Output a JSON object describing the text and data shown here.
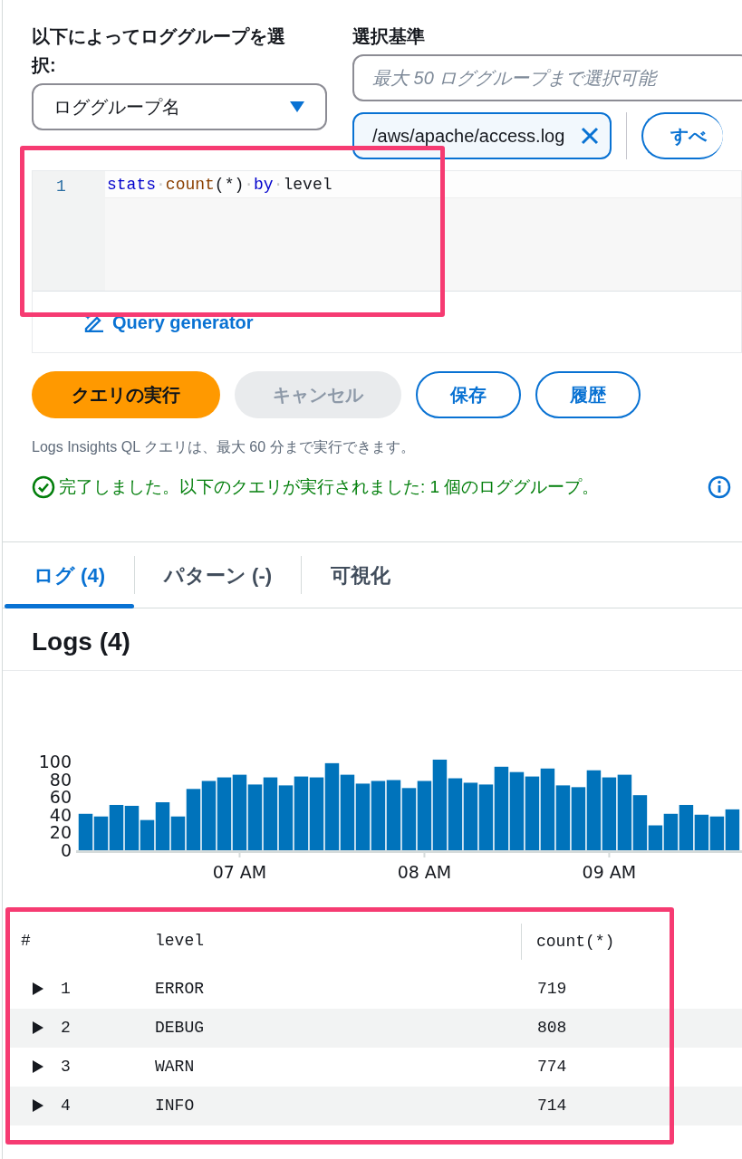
{
  "log_group_selector": {
    "label": "以下によってロググループを選択:",
    "value": "ロググループ名"
  },
  "criteria": {
    "label": "選択基準",
    "placeholder": "最大 50 ロググループまで選択可能",
    "tokens": [
      {
        "label": "/aws/apache/access.log"
      }
    ],
    "button": "すべ"
  },
  "editor": {
    "highlighted": true,
    "lines": [
      {
        "number": "1",
        "tokens": [
          {
            "text": "stats",
            "kind": "keyword"
          },
          {
            "text": "·",
            "kind": "space"
          },
          {
            "text": "count",
            "kind": "function"
          },
          {
            "text": "(*)",
            "kind": "plain"
          },
          {
            "text": "·",
            "kind": "space"
          },
          {
            "text": "by",
            "kind": "keyword"
          },
          {
            "text": "·",
            "kind": "space"
          },
          {
            "text": "level",
            "kind": "plain"
          }
        ]
      }
    ],
    "query_generator": "Query generator"
  },
  "buttons": [
    {
      "label": "クエリの実行",
      "kind": "primary"
    },
    {
      "label": "キャンセル",
      "kind": "disabled"
    },
    {
      "label": "保存",
      "kind": "outline"
    },
    {
      "label": "履歴",
      "kind": "outline"
    }
  ],
  "hint": "Logs Insights QL クエリは、最大 60 分まで実行できます。",
  "status": {
    "kind": "success",
    "text": "完了しました。以下のクエリが実行されました: 1 個のロググループ。"
  },
  "tabs": [
    {
      "label": "ログ (4)",
      "selected": true
    },
    {
      "label": "パターン (-)",
      "selected": false
    },
    {
      "label": "可視化",
      "selected": false
    }
  ],
  "logs_heading": "Logs (4)",
  "chart_data": {
    "type": "bar",
    "categories": [
      null,
      null,
      null,
      null,
      null,
      null,
      null,
      null,
      null,
      null,
      "07 AM",
      null,
      null,
      null,
      null,
      null,
      null,
      null,
      null,
      null,
      null,
      null,
      "08 AM",
      null,
      null,
      null,
      null,
      null,
      null,
      null,
      null,
      null,
      null,
      null,
      "09 AM",
      null,
      null,
      null,
      null,
      null,
      null,
      null,
      null
    ],
    "values": [
      41,
      38,
      51,
      50,
      34,
      54,
      38,
      69,
      78,
      82,
      85,
      74,
      82,
      73,
      83,
      82,
      98,
      85,
      75,
      78,
      79,
      70,
      78,
      102,
      81,
      76,
      74,
      94,
      88,
      83,
      92,
      73,
      71,
      90,
      82,
      85,
      62,
      28,
      41,
      51,
      40,
      38,
      46
    ],
    "ylim": [
      0,
      105
    ],
    "yticks": [
      0,
      20,
      40,
      60,
      80,
      100
    ]
  },
  "table": {
    "highlighted": true,
    "columns": [
      "#",
      "level",
      "count(*)"
    ],
    "rows": [
      {
        "number": "1",
        "level": "ERROR",
        "count": "719",
        "expanded": false
      },
      {
        "number": "2",
        "level": "DEBUG",
        "count": "808",
        "expanded": false
      },
      {
        "number": "3",
        "level": "WARN",
        "count": "774",
        "expanded": false
      },
      {
        "number": "4",
        "level": "INFO",
        "count": "714",
        "expanded": false
      }
    ]
  }
}
